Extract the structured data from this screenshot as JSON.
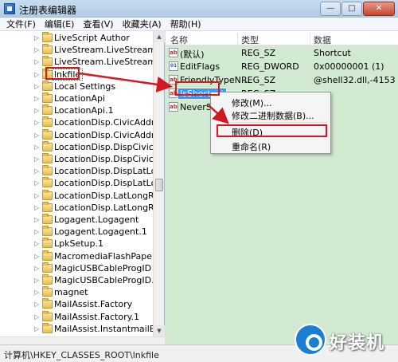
{
  "window": {
    "title": "注册表编辑器",
    "controls": [
      "—",
      "□",
      "✕"
    ]
  },
  "menu": [
    "文件(F)",
    "编辑(E)",
    "查看(V)",
    "收藏夹(A)",
    "帮助(H)"
  ],
  "tree": {
    "items": [
      {
        "label": "LiveScript Author"
      },
      {
        "label": "LiveStream.LiveStream"
      },
      {
        "label": "LiveStream.LiveStream.1"
      },
      {
        "label": "lnkfile",
        "selected": true
      },
      {
        "label": "Local Settings"
      },
      {
        "label": "LocationApi"
      },
      {
        "label": "LocationApi.1"
      },
      {
        "label": "LocationDisp.CivicAddressRe"
      },
      {
        "label": "LocationDisp.CivicAddressRe"
      },
      {
        "label": "LocationDisp.DispCivicAddre"
      },
      {
        "label": "LocationDisp.DispCivicAddre"
      },
      {
        "label": "LocationDisp.DispLatLongRe"
      },
      {
        "label": "LocationDisp.DispLatLongRe"
      },
      {
        "label": "LocationDisp.LatLongReport"
      },
      {
        "label": "LocationDisp.LatLongReport"
      },
      {
        "label": "Logagent.Logagent"
      },
      {
        "label": "Logagent.Logagent.1"
      },
      {
        "label": "LpkSetup.1"
      },
      {
        "label": "MacromediaFlashPaper.Mac"
      },
      {
        "label": "MagicUSBCableProgID"
      },
      {
        "label": "MagicUSBCableProgID.1"
      },
      {
        "label": "magnet"
      },
      {
        "label": "MailAssist.Factory"
      },
      {
        "label": "MailAssist.Factory.1"
      },
      {
        "label": "MailAssist.InstantmailEntry"
      }
    ]
  },
  "list": {
    "headers": {
      "name": "名称",
      "type": "类型",
      "data": "数据"
    },
    "rows": [
      {
        "icon": "ab",
        "name": "(默认)",
        "type": "REG_SZ",
        "data": "Shortcut"
      },
      {
        "icon": "bin",
        "name": "EditFlags",
        "type": "REG_DWORD",
        "data": "0x00000001 (1)"
      },
      {
        "icon": "ab",
        "name": "FriendlyTypeN...",
        "type": "REG_SZ",
        "data": "@shell32.dll,-4153"
      },
      {
        "icon": "ab",
        "name": "IsShortcut",
        "type": "REG_SZ",
        "data": "",
        "highlighted": true
      },
      {
        "icon": "ab",
        "name": "NeverSho",
        "type": "",
        "data": ""
      }
    ]
  },
  "context_menu": {
    "items": [
      "修改(M)...",
      "修改二进制数据(B)...",
      "删除(D)",
      "重命名(R)"
    ]
  },
  "status": {
    "path": "计算机\\HKEY_CLASSES_ROOT\\lnkfile"
  },
  "watermark": {
    "text": "好装机"
  },
  "colors": {
    "annotation_red": "#d31920",
    "list_bg": "#d2ead2",
    "selection_blue": "#3399ff"
  }
}
